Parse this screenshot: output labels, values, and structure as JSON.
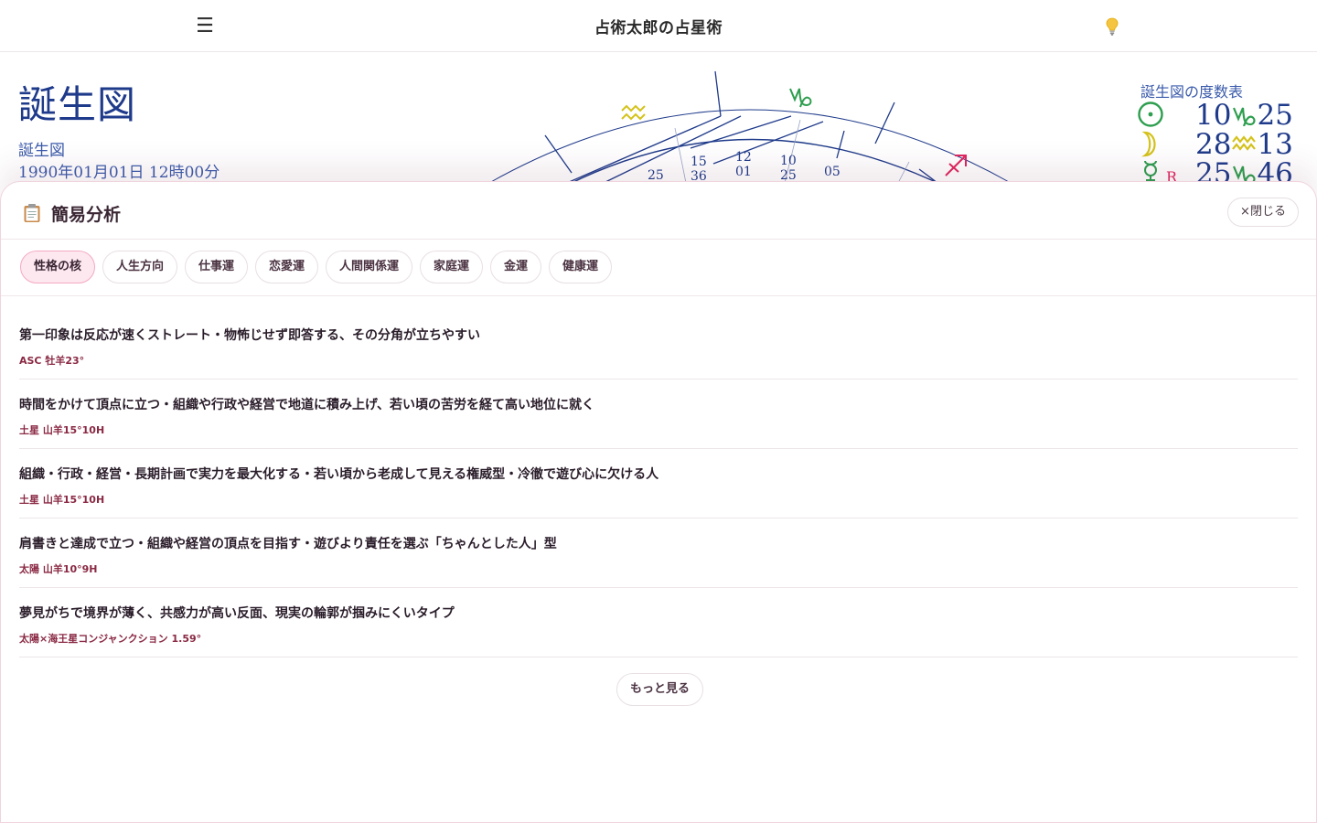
{
  "header": {
    "menu_glyph": "☰",
    "site_title": "占術太郎の占星術",
    "hint_icon": "lightbulb-icon"
  },
  "chart_page": {
    "title": "誕生図",
    "subtitle": "誕生図",
    "datetime": "1990年01月01日 12時00分",
    "wheel_numbers": [
      {
        "top": "25",
        "bottom": ""
      },
      {
        "top": "15",
        "bottom": "36"
      },
      {
        "top": "12",
        "bottom": "01"
      },
      {
        "top": "10",
        "bottom": "25"
      },
      {
        "top": "05",
        "bottom": ""
      }
    ],
    "sign_icons": [
      "aquarius-icon",
      "capricorn-icon",
      "sagittarius-icon"
    ],
    "degree_table": {
      "title": "誕生図の度数表",
      "rows": [
        {
          "planet": "sun-icon",
          "deg": "10",
          "sign": "capricorn-icon",
          "min": "25"
        },
        {
          "planet": "moon-icon",
          "deg": "28",
          "sign": "aquarius-icon",
          "min": "13"
        },
        {
          "planet": "mercury-icon",
          "retro": "R",
          "deg": "25",
          "sign": "capricorn-icon",
          "min": "46"
        }
      ]
    },
    "colors": {
      "chart_blue": "#1e3a8a",
      "capricorn_green": "#2e9e4f",
      "aquarius_yellow": "#d4c21a",
      "sagittarius_pink": "#e0245e"
    }
  },
  "sheet": {
    "title": "簡易分析",
    "icon": "clipboard-icon",
    "close_label": "×閉じる",
    "tabs": [
      {
        "label": "性格の核",
        "active": true
      },
      {
        "label": "人生方向"
      },
      {
        "label": "仕事運"
      },
      {
        "label": "恋愛運"
      },
      {
        "label": "人間関係運"
      },
      {
        "label": "家庭運"
      },
      {
        "label": "金運"
      },
      {
        "label": "健康運"
      }
    ],
    "items": [
      {
        "text": "第一印象は反応が速くストレート・物怖じせず即答する、その分角が立ちやすい",
        "source": "ASC 牡羊23°"
      },
      {
        "text": "時間をかけて頂点に立つ・組織や行政や経営で地道に積み上げ、若い頃の苦労を経て高い地位に就く",
        "source": "土星 山羊15°10H"
      },
      {
        "text": "組織・行政・経営・長期計画で実力を最大化する・若い頃から老成して見える権威型・冷徹で遊び心に欠ける人",
        "source": "土星 山羊15°10H"
      },
      {
        "text": "肩書きと達成で立つ・組織や経営の頂点を目指す・遊びより責任を選ぶ「ちゃんとした人」型",
        "source": "太陽 山羊10°9H"
      },
      {
        "text": "夢見がちで境界が薄く、共感力が高い反面、現実の輪郭が掴みにくいタイプ",
        "source": "太陽×海王星コンジャンクション 1.59°"
      }
    ],
    "more_label": "もっと見る",
    "accent": "#f4a9c3",
    "source_color": "#8a2944"
  }
}
